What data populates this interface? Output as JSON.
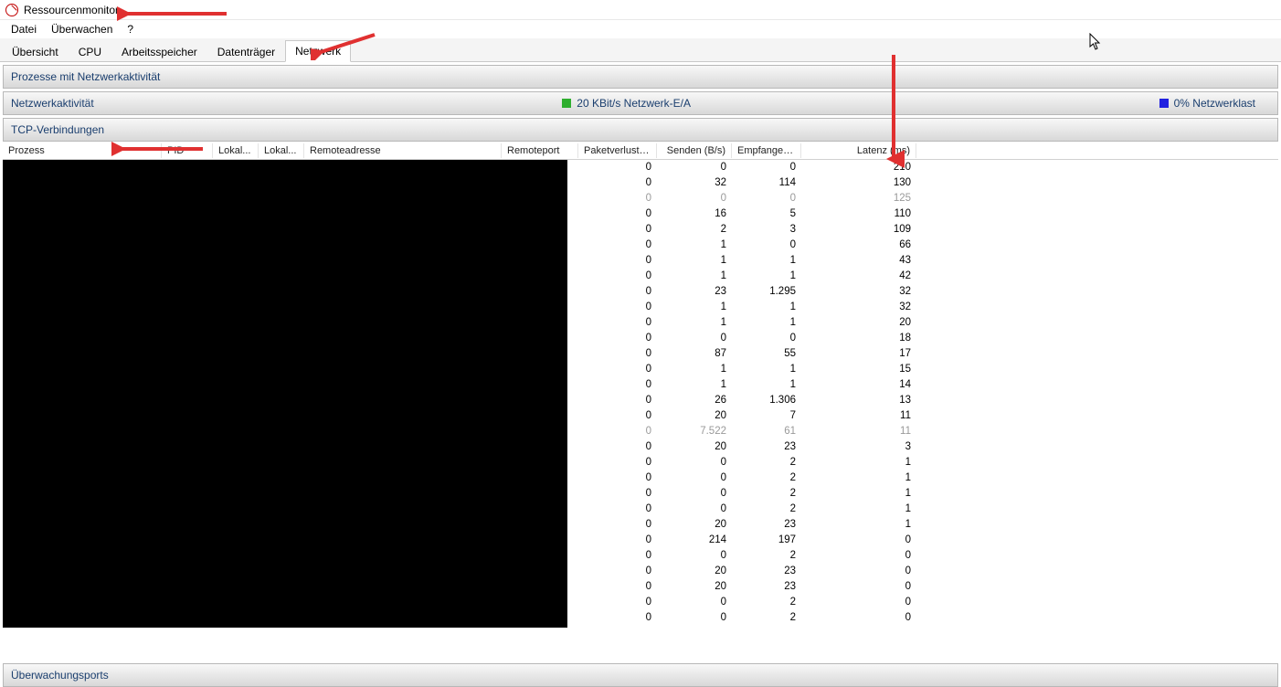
{
  "window": {
    "title": "Ressourcenmonitor"
  },
  "menu": {
    "items": [
      "Datei",
      "Überwachen",
      "?"
    ]
  },
  "tabs": {
    "items": [
      "Übersicht",
      "CPU",
      "Arbeitsspeicher",
      "Datenträger",
      "Netzwerk"
    ],
    "active_index": 4
  },
  "sections": {
    "processes_header": "Prozesse mit Netzwerkaktivität",
    "activity": {
      "title": "Netzwerkaktivität",
      "io_text": "20 KBit/s Netzwerk-E/A",
      "load_text": "0% Netzwerklast"
    },
    "tcp": {
      "title": "TCP-Verbindungen",
      "columns": {
        "proc": "Prozess",
        "pid": "PID",
        "lokal1": "Lokal...",
        "lokal2": "Lokal...",
        "remadr": "Remoteadresse",
        "remport": "Remoteport",
        "loss": "Paketverlust (%)",
        "send": "Senden (B/s)",
        "recv": "Empfangen...",
        "lat": "Latenz (ms)"
      },
      "rows": [
        {
          "loss": "0",
          "send": "0",
          "recv": "0",
          "lat": "210",
          "dim": false
        },
        {
          "loss": "0",
          "send": "32",
          "recv": "114",
          "lat": "130",
          "dim": false
        },
        {
          "loss": "0",
          "send": "0",
          "recv": "0",
          "lat": "125",
          "dim": true
        },
        {
          "loss": "0",
          "send": "16",
          "recv": "5",
          "lat": "110",
          "dim": false
        },
        {
          "loss": "0",
          "send": "2",
          "recv": "3",
          "lat": "109",
          "dim": false
        },
        {
          "loss": "0",
          "send": "1",
          "recv": "0",
          "lat": "66",
          "dim": false
        },
        {
          "loss": "0",
          "send": "1",
          "recv": "1",
          "lat": "43",
          "dim": false
        },
        {
          "loss": "0",
          "send": "1",
          "recv": "1",
          "lat": "42",
          "dim": false
        },
        {
          "loss": "0",
          "send": "23",
          "recv": "1.295",
          "lat": "32",
          "dim": false
        },
        {
          "loss": "0",
          "send": "1",
          "recv": "1",
          "lat": "32",
          "dim": false
        },
        {
          "loss": "0",
          "send": "1",
          "recv": "1",
          "lat": "20",
          "dim": false
        },
        {
          "loss": "0",
          "send": "0",
          "recv": "0",
          "lat": "18",
          "dim": false
        },
        {
          "loss": "0",
          "send": "87",
          "recv": "55",
          "lat": "17",
          "dim": false
        },
        {
          "loss": "0",
          "send": "1",
          "recv": "1",
          "lat": "15",
          "dim": false
        },
        {
          "loss": "0",
          "send": "1",
          "recv": "1",
          "lat": "14",
          "dim": false
        },
        {
          "loss": "0",
          "send": "26",
          "recv": "1.306",
          "lat": "13",
          "dim": false
        },
        {
          "loss": "0",
          "send": "20",
          "recv": "7",
          "lat": "11",
          "dim": false
        },
        {
          "loss": "0",
          "send": "7.522",
          "recv": "61",
          "lat": "11",
          "dim": true
        },
        {
          "loss": "0",
          "send": "20",
          "recv": "23",
          "lat": "3",
          "dim": false
        },
        {
          "loss": "0",
          "send": "0",
          "recv": "2",
          "lat": "1",
          "dim": false
        },
        {
          "loss": "0",
          "send": "0",
          "recv": "2",
          "lat": "1",
          "dim": false
        },
        {
          "loss": "0",
          "send": "0",
          "recv": "2",
          "lat": "1",
          "dim": false
        },
        {
          "loss": "0",
          "send": "0",
          "recv": "2",
          "lat": "1",
          "dim": false
        },
        {
          "loss": "0",
          "send": "20",
          "recv": "23",
          "lat": "1",
          "dim": false
        },
        {
          "loss": "0",
          "send": "214",
          "recv": "197",
          "lat": "0",
          "dim": false
        },
        {
          "loss": "0",
          "send": "0",
          "recv": "2",
          "lat": "0",
          "dim": false
        },
        {
          "loss": "0",
          "send": "20",
          "recv": "23",
          "lat": "0",
          "dim": false
        },
        {
          "loss": "0",
          "send": "20",
          "recv": "23",
          "lat": "0",
          "dim": false
        },
        {
          "loss": "0",
          "send": "0",
          "recv": "2",
          "lat": "0",
          "dim": false
        },
        {
          "loss": "0",
          "send": "0",
          "recv": "2",
          "lat": "0",
          "dim": false
        }
      ]
    },
    "ports_header": "Überwachungsports"
  },
  "annotation_color": "#e03030"
}
